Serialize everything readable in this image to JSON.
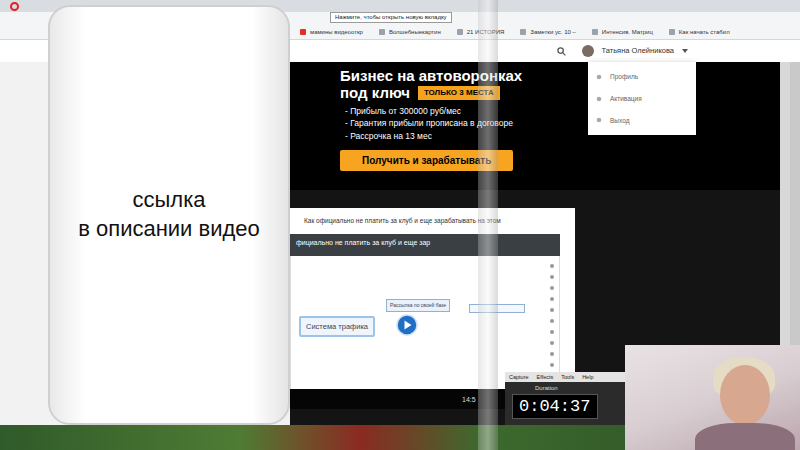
{
  "browser": {
    "tooltip": "Нажмите, чтобы открыть новую вкладку",
    "bookmarks": [
      "мамины видеооткр",
      "Волшебныекартин",
      "21 ИСТОРИЯ",
      "Заметки ус. 10 –",
      "Интенсив. Матриц",
      "Как начать стабил"
    ]
  },
  "site": {
    "user": "Татьяна Олейникова",
    "user_menu": [
      "Профиль",
      "Активация",
      "Выход"
    ]
  },
  "banner": {
    "title": "Бизнес на автоворонках",
    "subtitle": "под ключ",
    "tag": "ТОЛЬКО 3 МЕСТА",
    "bullets": [
      "- Прибыль от 300000 руб/мес",
      "- Гарантия прибыли прописана в договоре",
      "- Рассрочка на 13 мес"
    ],
    "button": "Получить и зарабатывать"
  },
  "lesson": {
    "title": "Как официально не платить за клуб и еще зарабатывать на этом",
    "video": {
      "title": "фициально не платить за клуб и еще зар",
      "nodes": [
        {
          "label": "Система трафика",
          "kind": "button"
        },
        {
          "label": "Рассылка по своей базе",
          "kind": "note"
        }
      ],
      "time": "14:5"
    }
  },
  "overlay": {
    "lines": [
      "ссылка",
      "в описании видео"
    ]
  },
  "recorder": {
    "menu": [
      "Capture",
      "Effects",
      "Tools",
      "Help"
    ],
    "label": "Duration",
    "time": "0:04:37"
  }
}
